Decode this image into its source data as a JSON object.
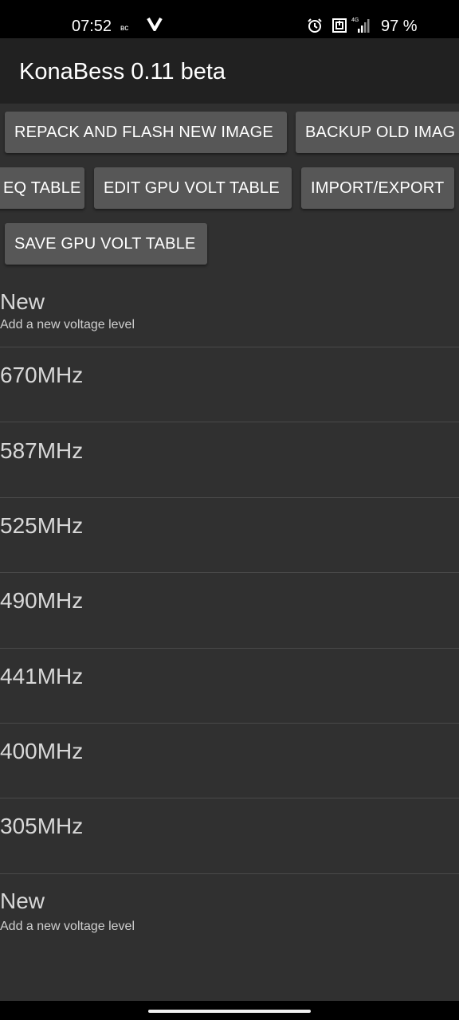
{
  "status_bar": {
    "time": "07:52",
    "day": "вс",
    "battery": "97 %",
    "network": "4G",
    "icons": [
      "v-logo-icon",
      "alarm-icon",
      "nfc-icon",
      "signal-icon"
    ]
  },
  "app_bar": {
    "title": "KonaBess 0.11 beta"
  },
  "toolbar": {
    "repack_flash": "REPACK AND FLASH NEW IMAGE",
    "backup_old": "BACKUP OLD IMAG",
    "freq_table": "EQ TABLE",
    "edit_gpu_volt": "EDIT GPU VOLT TABLE",
    "import_export": "IMPORT/EXPORT",
    "save_gpu_volt": "SAVE GPU VOLT TABLE"
  },
  "list": {
    "add_top": {
      "title": "New",
      "subtitle": "Add a new voltage level"
    },
    "levels": [
      "670MHz",
      "587MHz",
      "525MHz",
      "490MHz",
      "441MHz",
      "400MHz",
      "305MHz"
    ],
    "add_bottom": {
      "title": "New",
      "subtitle": "Add a new voltage level"
    }
  },
  "colors": {
    "background": "#303030",
    "app_bar": "#212121",
    "button": "#575757",
    "divider": "#4a4a4a",
    "status_bar": "#000000"
  }
}
